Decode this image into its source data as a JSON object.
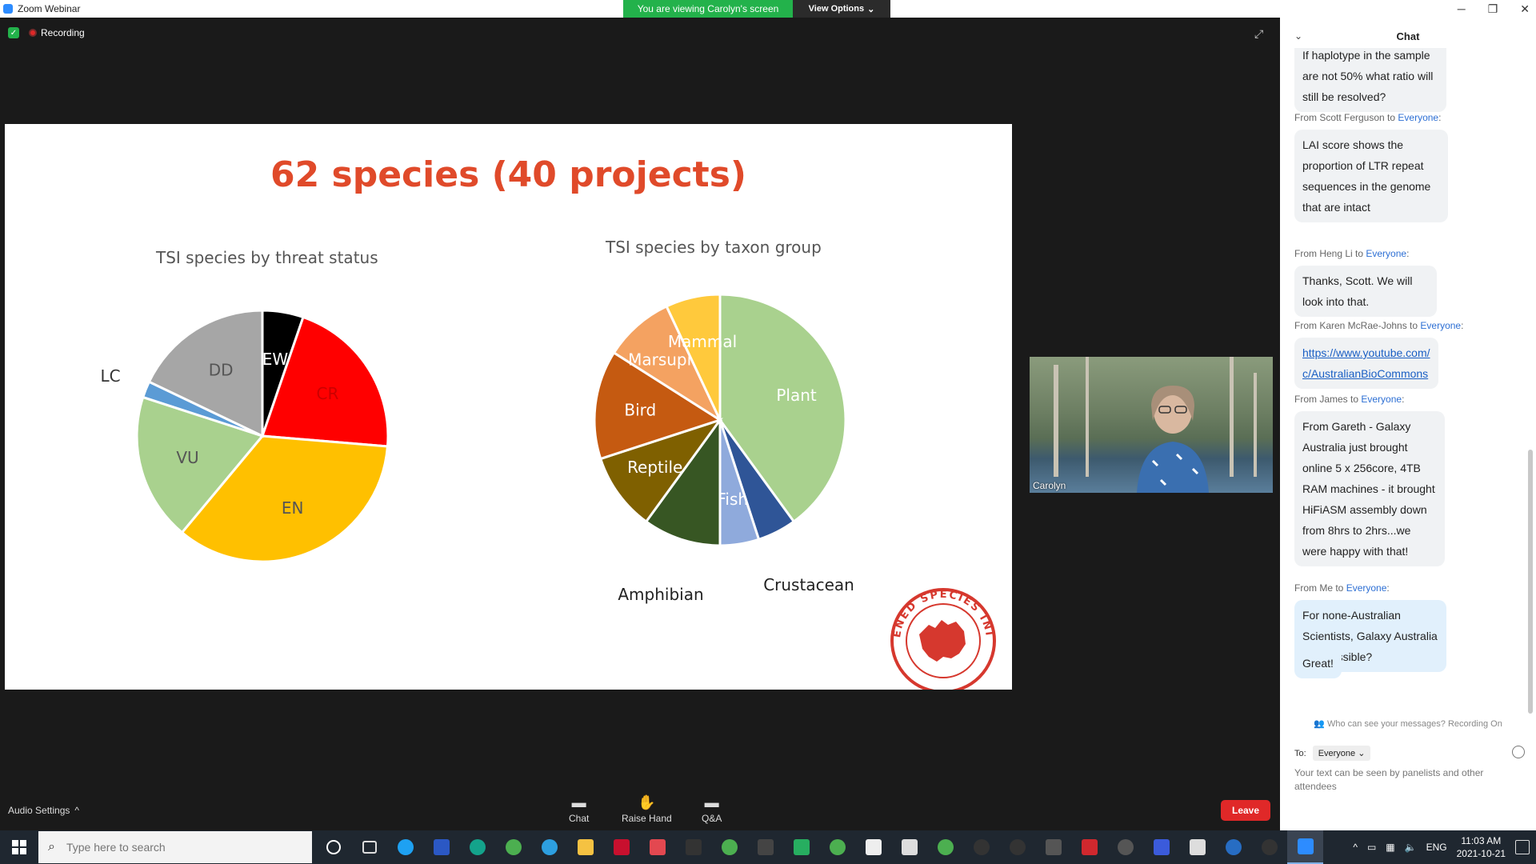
{
  "window": {
    "title": "Zoom Webinar"
  },
  "share_banner": {
    "viewing_text": "You are viewing Carolyn's screen",
    "view_options": "View Options"
  },
  "meeting": {
    "recording_label": "Recording"
  },
  "slide": {
    "title": "62 species (40 projects)",
    "stamp_text": "THREATENED SPECIES INITIATIVE",
    "charts_meta": {
      "logo": "threatened-species-initiative-logo"
    }
  },
  "chart_data": [
    {
      "type": "pie",
      "title": "TSI species by threat status",
      "slices": [
        {
          "label": "EW",
          "value": 5,
          "color": "#000000"
        },
        {
          "label": "CR",
          "value": 20,
          "color": "#ff0000"
        },
        {
          "label": "EN",
          "value": 33,
          "color": "#ffc000"
        },
        {
          "label": "VU",
          "value": 18,
          "color": "#a9d18e"
        },
        {
          "label": "LC",
          "value": 2,
          "color": "#5b9bd5"
        },
        {
          "label": "DD",
          "value": 17,
          "color": "#a6a6a6"
        }
      ]
    },
    {
      "type": "pie",
      "title": "TSI species by taxon group",
      "slices": [
        {
          "label": "Plant",
          "value": 40,
          "color": "#a9d18e"
        },
        {
          "label": "Crustacean",
          "value": 5,
          "color": "#2f5597"
        },
        {
          "label": "Fish",
          "value": 5,
          "color": "#8faadc"
        },
        {
          "label": "Amphibian",
          "value": 10,
          "color": "#375623"
        },
        {
          "label": "Reptile",
          "value": 10,
          "color": "#7f6000"
        },
        {
          "label": "Bird",
          "value": 14,
          "color": "#c55a11"
        },
        {
          "label": "Marsupial",
          "value": 9,
          "color": "#f4a261"
        },
        {
          "label": "Mammal",
          "value": 7,
          "color": "#ffc93c"
        }
      ]
    }
  ],
  "video": {
    "participant_name": "Carolyn"
  },
  "toolbar": {
    "audio_settings": "Audio Settings",
    "chat": "Chat",
    "raise_hand": "Raise Hand",
    "qa": "Q&A",
    "leave": "Leave"
  },
  "chat": {
    "title": "Chat",
    "messages": [
      {
        "from": "",
        "to": "",
        "text": "If haplotype in the sample are not 50% what ratio will still be resolved?"
      },
      {
        "from": "From Scott Ferguson to ",
        "to": "Everyone",
        "text": "LAI score shows the proportion of LTR repeat sequences in the genome that are intact"
      },
      {
        "from": "From Heng Li to ",
        "to": "Everyone",
        "text": "Thanks, Scott. We will look into that."
      },
      {
        "from": "From Karen McRae-Johns to ",
        "to": "Everyone",
        "text": "https://www.youtube.com/c/AustralianBioCommons"
      },
      {
        "from": "From James to ",
        "to": "Everyone",
        "text": "From Gareth - Galaxy Australia just brought online 5 x 256core, 4TB RAM machines - it brought HiFiASM assembly down from 8hrs to 2hrs...we were happy with that!"
      },
      {
        "from": "From Me to ",
        "to": "Everyone",
        "text": "For none-Australian Scientists, Galaxy Australia is accessible?"
      },
      {
        "from": "",
        "to": "",
        "text": "Great!"
      }
    ],
    "who_can_see": "Who can see your messages? Recording On",
    "to_label": "To:",
    "to_value": "Everyone",
    "input_hint": "Your text can be seen by panelists and other attendees"
  },
  "taskbar": {
    "search_placeholder": "Type here to search",
    "language": "ENG",
    "time": "11:03 AM",
    "date": "2021-10-21"
  }
}
